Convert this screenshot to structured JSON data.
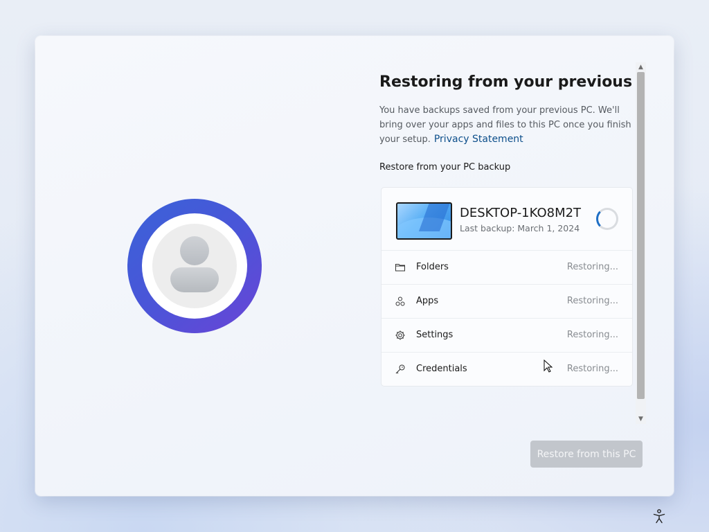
{
  "title": "Restoring from your previous PC ..",
  "description": "You have backups saved from your previous PC. We'll bring over your apps and files to this PC once you finish your setup.",
  "privacy_link": "Privacy Statement",
  "section_label": "Restore from your PC backup",
  "backup": {
    "pc_name": "DESKTOP-1KO8M2T",
    "last_backup": "Last backup: March 1, 2024"
  },
  "items": [
    {
      "label": "Folders",
      "status": "Restoring...",
      "icon": "folder-icon"
    },
    {
      "label": "Apps",
      "status": "Restoring...",
      "icon": "apps-icon"
    },
    {
      "label": "Settings",
      "status": "Restoring...",
      "icon": "gear-icon"
    },
    {
      "label": "Credentials",
      "status": "Restoring...",
      "icon": "key-icon"
    }
  ],
  "button_label": "Restore from this PC",
  "colors": {
    "accent": "#1f6fc5",
    "link": "#0d4f8b",
    "avatar_ring_start": "#3a63d8",
    "avatar_ring_end": "#6a44d6",
    "button_disabled": "#c2c6cc"
  }
}
